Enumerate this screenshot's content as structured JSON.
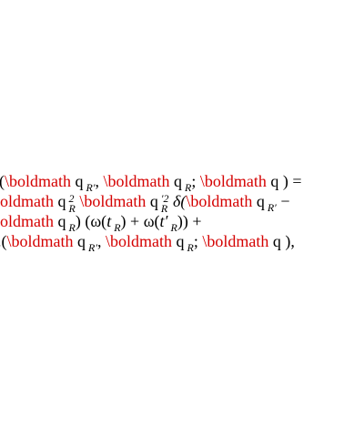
{
  "macro": "\\boldmath",
  "colors": {
    "error_macro": "#d40000",
    "text": "#000000"
  },
  "lines": {
    "l1": {
      "open": "(",
      "q": " q",
      "sub_rp": "R′",
      "comma": ", ",
      "sub_r": "R",
      "semi": "; ",
      "close": " q ) ="
    },
    "l2": {
      "q": " q",
      "sup1": "2",
      "sub1": "R",
      "sup2": "′2",
      "sub2": "R",
      "delta": " δ(",
      "sub3": "R′",
      "minus": " −"
    },
    "l3": {
      "q": " q",
      "sub1": "R",
      "mid": ") (ω(",
      "t": "t",
      "sub2": "R",
      "plus": ") + ω(",
      "tp": "t′",
      "sub3": "R",
      "end": "))  +"
    },
    "l4": {
      "open": ".(",
      "q": " q",
      "sub_rp": "R′",
      "comma": ", ",
      "sub_r": "R",
      "semi": "; ",
      "close": " q ),"
    }
  }
}
